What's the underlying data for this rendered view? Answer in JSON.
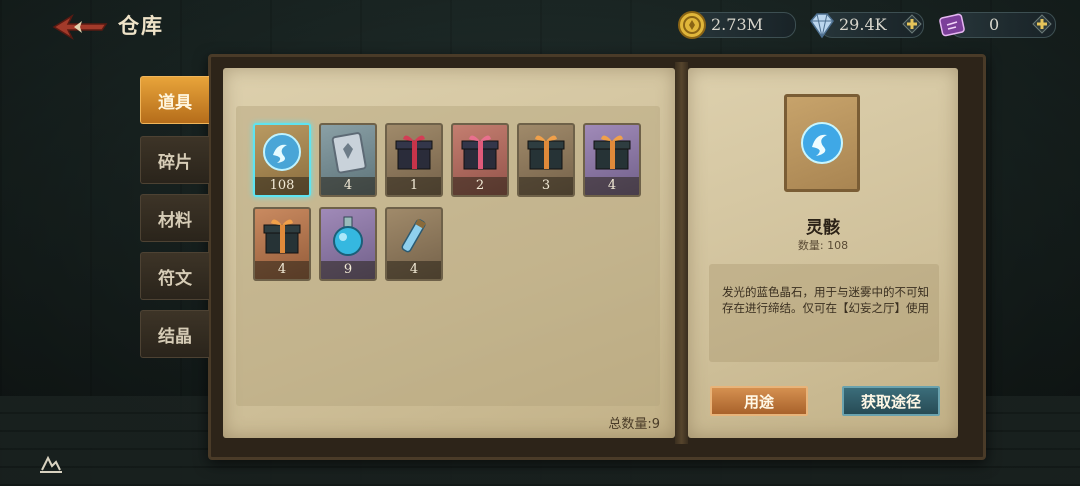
{
  "header": {
    "title": "仓库",
    "back_icon": "back-arrow-icon"
  },
  "currencies": [
    {
      "name": "gold",
      "icon": "gold-coin-icon",
      "value": "2.73M",
      "has_plus": false
    },
    {
      "name": "diamond",
      "icon": "diamond-icon",
      "value": "29.4K",
      "has_plus": true
    },
    {
      "name": "ticket",
      "icon": "purple-ticket-icon",
      "value": "0",
      "has_plus": true
    }
  ],
  "tabs": [
    {
      "label": "道具",
      "active": true
    },
    {
      "label": "碎片",
      "active": false
    },
    {
      "label": "材料",
      "active": false
    },
    {
      "label": "符文",
      "active": false
    },
    {
      "label": "结晶",
      "active": false
    }
  ],
  "items": [
    {
      "icon": "blue-swirl-crystal-icon",
      "count": "108",
      "quality": "gold",
      "selected": true
    },
    {
      "icon": "silver-card-icon",
      "count": "4",
      "quality": "silver",
      "selected": false
    },
    {
      "icon": "red-gift-box-icon",
      "count": "1",
      "quality": "bronze",
      "selected": false
    },
    {
      "icon": "red-gift-box-icon",
      "count": "2",
      "quality": "red",
      "selected": false
    },
    {
      "icon": "orange-gift-box-icon",
      "count": "3",
      "quality": "bronze",
      "selected": false
    },
    {
      "icon": "orange-gift-box-icon",
      "count": "4",
      "quality": "purple",
      "selected": false
    },
    {
      "icon": "orange-gift-box-icon",
      "count": "4",
      "quality": "orange",
      "selected": false
    },
    {
      "icon": "blue-potion-icon",
      "count": "9",
      "quality": "purple",
      "selected": false
    },
    {
      "icon": "blue-vial-icon",
      "count": "4",
      "quality": "bronze",
      "selected": false
    }
  ],
  "total_label": "总数量:9",
  "detail": {
    "name": "灵骸",
    "quantity_label": "数量: 108",
    "description": "发光的蓝色晶石，用于与迷雾中的不可知存在进行缔结。仅可在【幻妄之厅】使用",
    "use_button": "用途",
    "obtain_button": "获取途径"
  },
  "colors": {
    "accent_tab": "#e8a43a",
    "selected_border": "#5fe3f0",
    "use_button": "#c27a3c",
    "obtain_button": "#2f5d68"
  }
}
